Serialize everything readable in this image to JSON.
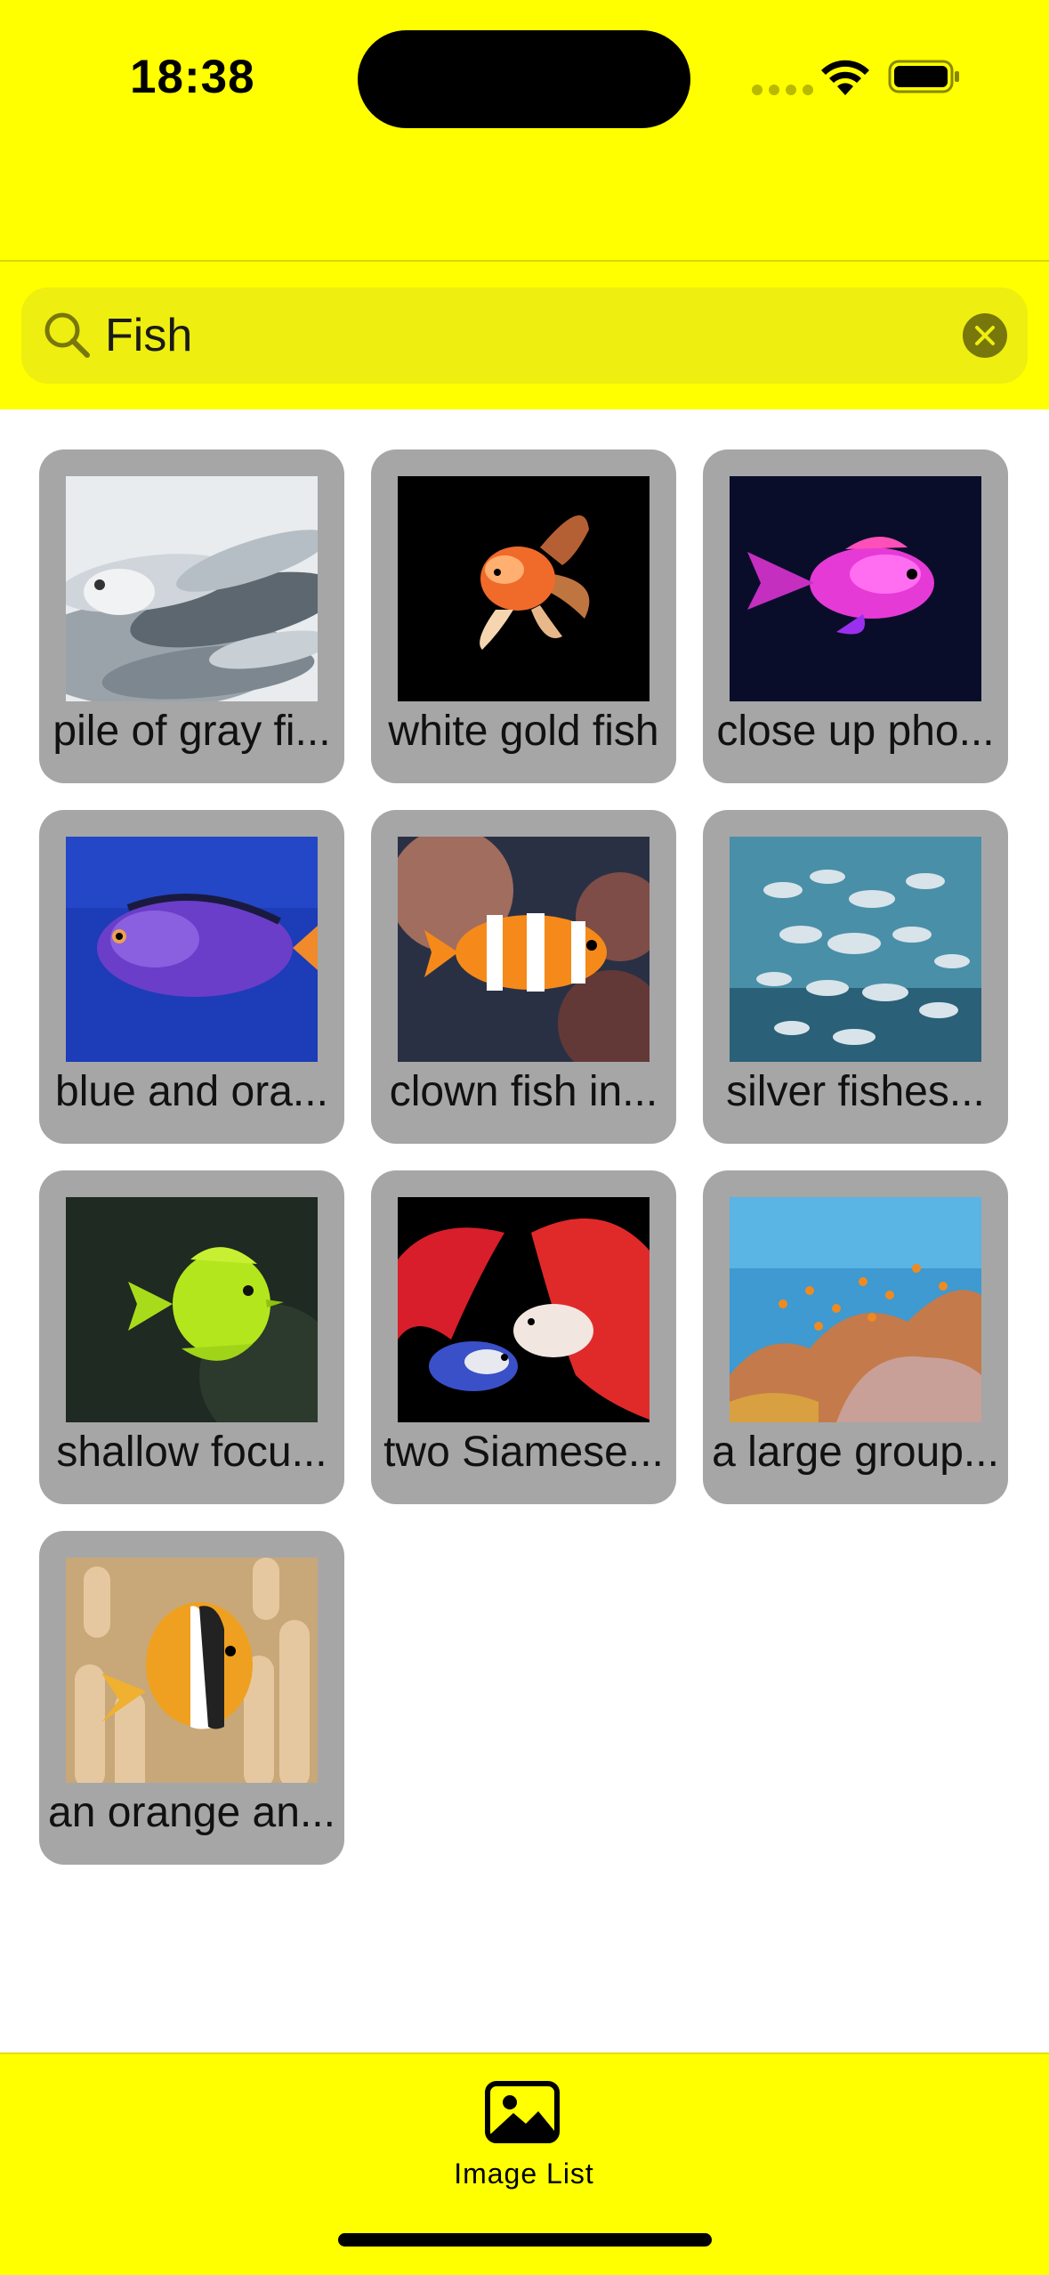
{
  "status_bar": {
    "time": "18:38"
  },
  "search": {
    "query": "Fish"
  },
  "results": [
    {
      "caption": "pile of gray fi...",
      "image": "gray-fish-pile"
    },
    {
      "caption": "white gold fish",
      "image": "goldfish"
    },
    {
      "caption": "close up pho...",
      "image": "pink-fish"
    },
    {
      "caption": "blue and ora...",
      "image": "blue-tang"
    },
    {
      "caption": "clown fish in...",
      "image": "clownfish"
    },
    {
      "caption": "silver fishes...",
      "image": "fish-school"
    },
    {
      "caption": "shallow focu...",
      "image": "yellow-tang"
    },
    {
      "caption": "two Siamese...",
      "image": "betta-fish"
    },
    {
      "caption": "a large group...",
      "image": "coral-reef"
    },
    {
      "caption": "an orange an...",
      "image": "anemone-clownfish"
    }
  ],
  "tabbar": {
    "tabs": [
      {
        "label": "Image List",
        "icon": "photo-icon"
      }
    ]
  },
  "colors": {
    "accent": "#ffff00",
    "search_bg": "#eeee10",
    "card_bg": "#a6a6a6"
  }
}
